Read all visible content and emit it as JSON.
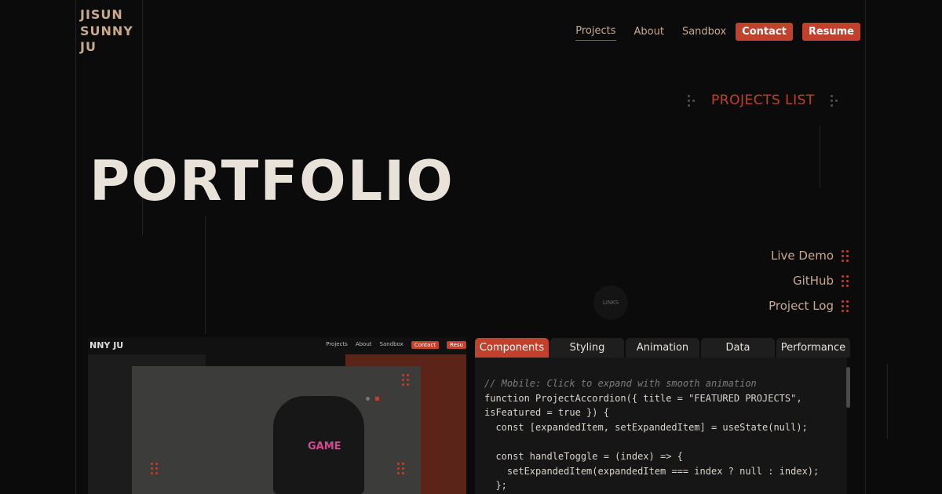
{
  "brand": {
    "name": "JISUN\nSUNNY\nJU"
  },
  "nav": {
    "items": [
      "Projects",
      "About",
      "Sandbox"
    ],
    "cta": [
      "Contact",
      "Resume"
    ]
  },
  "projects_list": {
    "label": "PROJECTS LIST"
  },
  "hero": {
    "title": "PORTFOLIO"
  },
  "links": [
    "Live Demo",
    "GitHub",
    "Project Log"
  ],
  "circle_badge": {
    "text": "LINKS"
  },
  "preview": {
    "brand": "NNY JU",
    "nav": [
      "Projects",
      "About",
      "Sandbox"
    ],
    "cta": [
      "Contact",
      "Resu"
    ],
    "art_text": "GAME"
  },
  "code_panel": {
    "tabs": [
      "Components",
      "Styling",
      "Animation",
      "Data",
      "Performance"
    ],
    "active_tab": "Components",
    "comment": "// Mobile: Click to expand with smooth animation",
    "lines": [
      "function ProjectAccordion({ title = \"FEATURED PROJECTS\",",
      "isFeatured = true }) {",
      "  const [expandedItem, setExpandedItem] = useState(null);",
      "",
      "  const handleToggle = (index) => {",
      "    setExpandedItem(expandedItem === index ? null : index);",
      "  };"
    ]
  },
  "colors": {
    "accent": "#c2412d",
    "background": "#0b0b0b",
    "text_light": "#e9e2d9",
    "text_muted": "#c9a98e"
  }
}
